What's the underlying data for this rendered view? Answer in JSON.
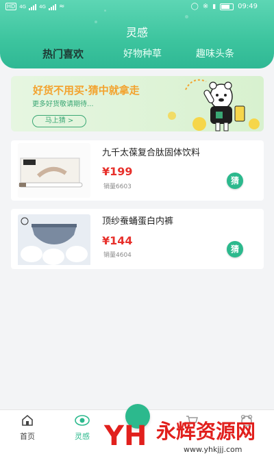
{
  "status_bar": {
    "left_indicator_1": "HD",
    "left_indicator_2": "HD",
    "network_1": "4G",
    "network_2": "4G",
    "time": "09:49"
  },
  "header": {
    "title": "灵感",
    "tabs": [
      "热门喜欢",
      "好物种草",
      "趣味头条"
    ]
  },
  "banner": {
    "title": "好货不用买·猜中就拿走",
    "subtitle": "更多好货敬请期待...",
    "button": "马上猜 >"
  },
  "products": [
    {
      "name": "九千太葆复合肽固体饮料",
      "price": "¥199",
      "sales": "销量6603",
      "guess_label": "猜"
    },
    {
      "name": "顶纱蚕蛹蛋白内裤",
      "price": "¥144",
      "sales": "销量4604",
      "guess_label": "猜"
    }
  ],
  "bottom_nav": {
    "items": [
      "首页",
      "灵感"
    ]
  },
  "watermark": {
    "logo": "YH",
    "title": "永辉资源网",
    "url": "www.yhkjjj.com"
  },
  "colors": {
    "accent": "#2cb98d",
    "header_top": "#5dd6b4",
    "price": "#e7302b",
    "banner_title": "#f3a22d"
  }
}
